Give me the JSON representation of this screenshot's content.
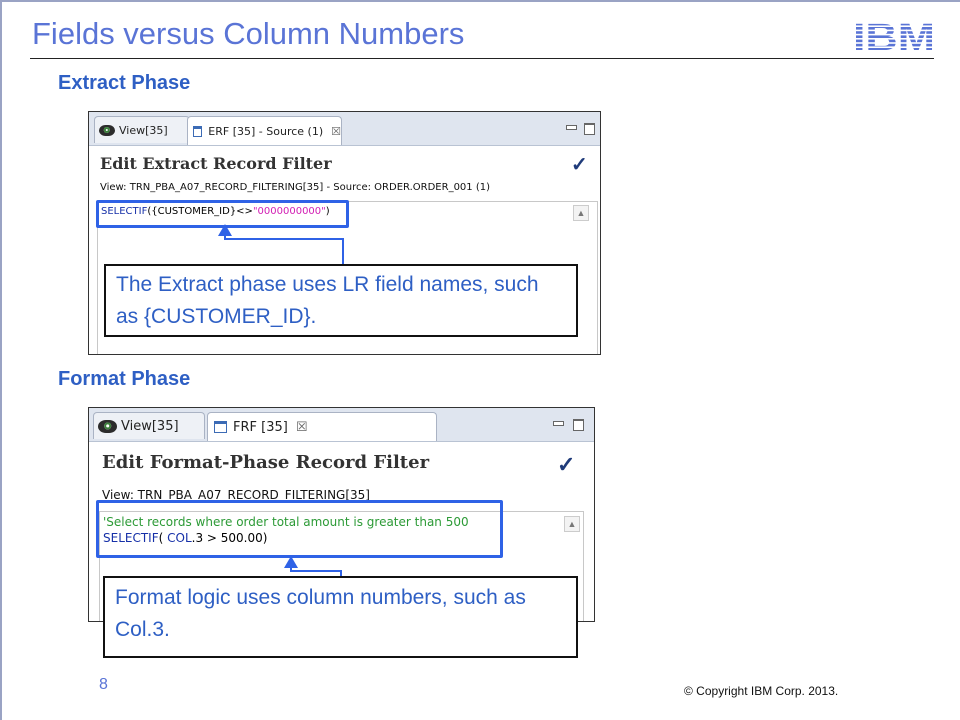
{
  "slide": {
    "title": "Fields versus Column Numbers",
    "logo_text": "IBM",
    "page_number": "8",
    "copyright": "© Copyright  IBM Corp. 2013.",
    "accent_color": "#5a74d6",
    "highlight_color": "#2f62e6"
  },
  "extract": {
    "heading": "Extract Phase",
    "tabs": [
      {
        "label": "View[35]",
        "icon": "eye-icon",
        "active": false
      },
      {
        "label": "ERF [35] - Source (1)",
        "icon": "document-icon",
        "active": true,
        "close": "☒"
      }
    ],
    "editor_title": "Edit Extract Record Filter",
    "checkmark": "✓",
    "view_line": "View: TRN_PBA_A07_RECORD_FILTERING[35] - Source: ORDER.ORDER_001 (1)",
    "code": {
      "keyword": "SELECTIF",
      "open": "({",
      "field": "CUSTOMER_ID",
      "op": "}<>",
      "literal": "\"0000000000\"",
      "close": ")"
    },
    "callout": "The Extract phase uses LR field names, such as {CUSTOMER_ID}."
  },
  "format": {
    "heading": "Format Phase",
    "tabs": [
      {
        "label": "View[35]",
        "icon": "eye-icon",
        "active": false
      },
      {
        "label": "FRF [35]",
        "icon": "document-icon",
        "active": true,
        "close": "☒"
      }
    ],
    "editor_title": "Edit Format-Phase Record Filter",
    "checkmark": "✓",
    "view_line": "View: TRN_PBA_A07_RECORD_FILTERING[35]",
    "code": {
      "comment": "'Select records where order total amount is greater than 500",
      "keyword": "SELECTIF",
      "open": "( ",
      "col": "COL",
      "rest": ".3  > 500.00)"
    },
    "callout": "Format logic uses column numbers, such as Col.3."
  }
}
